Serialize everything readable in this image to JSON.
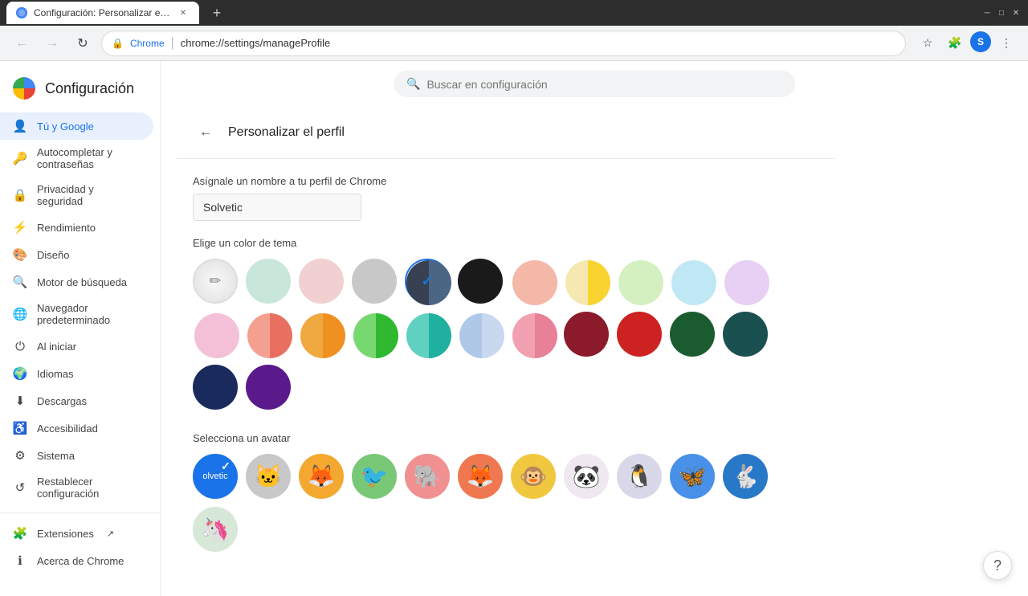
{
  "browser": {
    "tab_title": "Configuración: Personalizar el p...",
    "tab_favicon_label": "settings-favicon",
    "address_chrome_label": "Chrome",
    "address_separator": "|",
    "address_url": "chrome://settings/manageProfile"
  },
  "search": {
    "placeholder": "Buscar en configuración"
  },
  "sidebar": {
    "logo_title": "Configuración",
    "items": [
      {
        "id": "tu-y-google",
        "label": "Tú y Google",
        "icon": "👤",
        "active": true
      },
      {
        "id": "autocompletar",
        "label": "Autocompletar y contraseñas",
        "icon": "🔑",
        "active": false
      },
      {
        "id": "privacidad",
        "label": "Privacidad y seguridad",
        "icon": "🔒",
        "active": false
      },
      {
        "id": "rendimiento",
        "label": "Rendimiento",
        "icon": "⚡",
        "active": false
      },
      {
        "id": "diseno",
        "label": "Diseño",
        "icon": "🎨",
        "active": false
      },
      {
        "id": "motor",
        "label": "Motor de búsqueda",
        "icon": "🔍",
        "active": false
      },
      {
        "id": "navegador",
        "label": "Navegador predeterminado",
        "icon": "🌐",
        "active": false
      },
      {
        "id": "al-iniciar",
        "label": "Al iniciar",
        "icon": "⏻",
        "active": false
      },
      {
        "id": "idiomas",
        "label": "Idiomas",
        "icon": "🌍",
        "active": false
      },
      {
        "id": "descargas",
        "label": "Descargas",
        "icon": "⬇",
        "active": false
      },
      {
        "id": "accesibilidad",
        "label": "Accesibilidad",
        "icon": "♿",
        "active": false
      },
      {
        "id": "sistema",
        "label": "Sistema",
        "icon": "⚙",
        "active": false
      },
      {
        "id": "restablecer",
        "label": "Restablecer configuración",
        "icon": "↺",
        "active": false
      },
      {
        "id": "extensiones",
        "label": "Extensiones",
        "icon": "🧩",
        "active": false,
        "external": true
      },
      {
        "id": "acerca",
        "label": "Acerca de Chrome",
        "icon": "ℹ",
        "active": false
      }
    ]
  },
  "page": {
    "back_btn_label": "←",
    "title": "Personalizar el perfil",
    "profile_name_label": "Asígnale un nombre a tu perfil de Chrome",
    "profile_name_value": "Solvetic",
    "color_section_label": "Elige un color de tema",
    "avatar_section_label": "Selecciona un avatar"
  },
  "colors": [
    {
      "id": "custom",
      "type": "custom",
      "selected": false
    },
    {
      "id": "mint",
      "type": "solid",
      "color": "#c8e6da",
      "selected": false
    },
    {
      "id": "rose",
      "type": "solid",
      "color": "#f0d0d0",
      "selected": false
    },
    {
      "id": "gray",
      "type": "solid",
      "color": "#c8c8c8",
      "selected": false
    },
    {
      "id": "dark-gray-blue",
      "type": "half",
      "left": "#374151",
      "right": "#4b6584",
      "selected": true
    },
    {
      "id": "black",
      "type": "solid",
      "color": "#1a1a1a",
      "selected": false
    },
    {
      "id": "salmon-light",
      "type": "half",
      "left": "#f4b8a8",
      "right": "#f4b8a8",
      "selected": false
    },
    {
      "id": "yellow-light",
      "type": "half",
      "left": "#f5e8b0",
      "right": "#f9d430",
      "selected": false
    },
    {
      "id": "green-light",
      "type": "half",
      "left": "#d4f0c0",
      "right": "#d4f0c0",
      "selected": false
    },
    {
      "id": "cyan-light",
      "type": "half",
      "left": "#c0e8f4",
      "right": "#c0e8f4",
      "selected": false
    },
    {
      "id": "lavender-light",
      "type": "half",
      "left": "#e8d0f4",
      "right": "#e8d0f4",
      "selected": false
    },
    {
      "id": "pink-light",
      "type": "half",
      "left": "#f4c0d8",
      "right": "#f4c0d8",
      "selected": false
    },
    {
      "id": "salmon-mid",
      "type": "half",
      "left": "#f4a090",
      "right": "#e87060",
      "selected": false
    },
    {
      "id": "orange-mid",
      "type": "half",
      "left": "#f0a840",
      "right": "#f09020",
      "selected": false
    },
    {
      "id": "green-mid",
      "type": "half",
      "left": "#78d870",
      "right": "#30b830",
      "selected": false
    },
    {
      "id": "teal-mid",
      "type": "half",
      "left": "#60d0c0",
      "right": "#20b0a0",
      "selected": false
    },
    {
      "id": "blue-mid",
      "type": "half",
      "left": "#b0c8e8",
      "right": "#c8d8f0",
      "selected": false
    },
    {
      "id": "pink-mid",
      "type": "half",
      "left": "#f0a0b0",
      "right": "#e88098",
      "selected": false
    },
    {
      "id": "crimson",
      "type": "solid",
      "color": "#8b1a2a",
      "selected": false
    },
    {
      "id": "red",
      "type": "solid",
      "color": "#cc2222",
      "selected": false
    },
    {
      "id": "dark-green",
      "type": "solid",
      "color": "#1a5c30",
      "selected": false
    },
    {
      "id": "dark-teal",
      "type": "solid",
      "color": "#1a5050",
      "selected": false
    },
    {
      "id": "navy",
      "type": "solid",
      "color": "#1a2a5c",
      "selected": false
    },
    {
      "id": "purple",
      "type": "solid",
      "color": "#5a1a8b",
      "selected": false
    }
  ],
  "avatars": [
    {
      "id": "solvetic",
      "type": "text",
      "bg": "#1a73e8",
      "text": "olvetic",
      "selected": true
    },
    {
      "id": "cat",
      "type": "animal",
      "bg": "#c8c8c8",
      "emoji": "🐱",
      "color": "#888"
    },
    {
      "id": "fox",
      "type": "animal",
      "bg": "#f4a830",
      "emoji": "🦊",
      "color": "#e07818"
    },
    {
      "id": "crane",
      "type": "animal",
      "bg": "#78c878",
      "emoji": "🐦",
      "color": "#50a850"
    },
    {
      "id": "elephant",
      "type": "animal",
      "bg": "#f09090",
      "emoji": "🐘",
      "color": "#d06060"
    },
    {
      "id": "fox2",
      "type": "animal",
      "bg": "#f07850",
      "emoji": "🦊",
      "color": "#c85028"
    },
    {
      "id": "monkey",
      "type": "animal",
      "bg": "#f0c840",
      "emoji": "🐵",
      "color": "#c09820"
    },
    {
      "id": "panda",
      "type": "animal",
      "bg": "#f0e8f0",
      "emoji": "🐼",
      "color": "#b090b0"
    },
    {
      "id": "penguin",
      "type": "animal",
      "bg": "#d8d8e8",
      "emoji": "🐧",
      "color": "#a0a0c0"
    },
    {
      "id": "butterfly",
      "type": "animal",
      "bg": "#4890e8",
      "emoji": "🦋",
      "color": "#2060c0"
    },
    {
      "id": "rabbit",
      "type": "animal",
      "bg": "#2878c8",
      "emoji": "🐇",
      "color": "#1050a0"
    },
    {
      "id": "unicorn",
      "type": "animal",
      "bg": "#d8e8d8",
      "emoji": "🦄",
      "color": "#90b890"
    }
  ]
}
